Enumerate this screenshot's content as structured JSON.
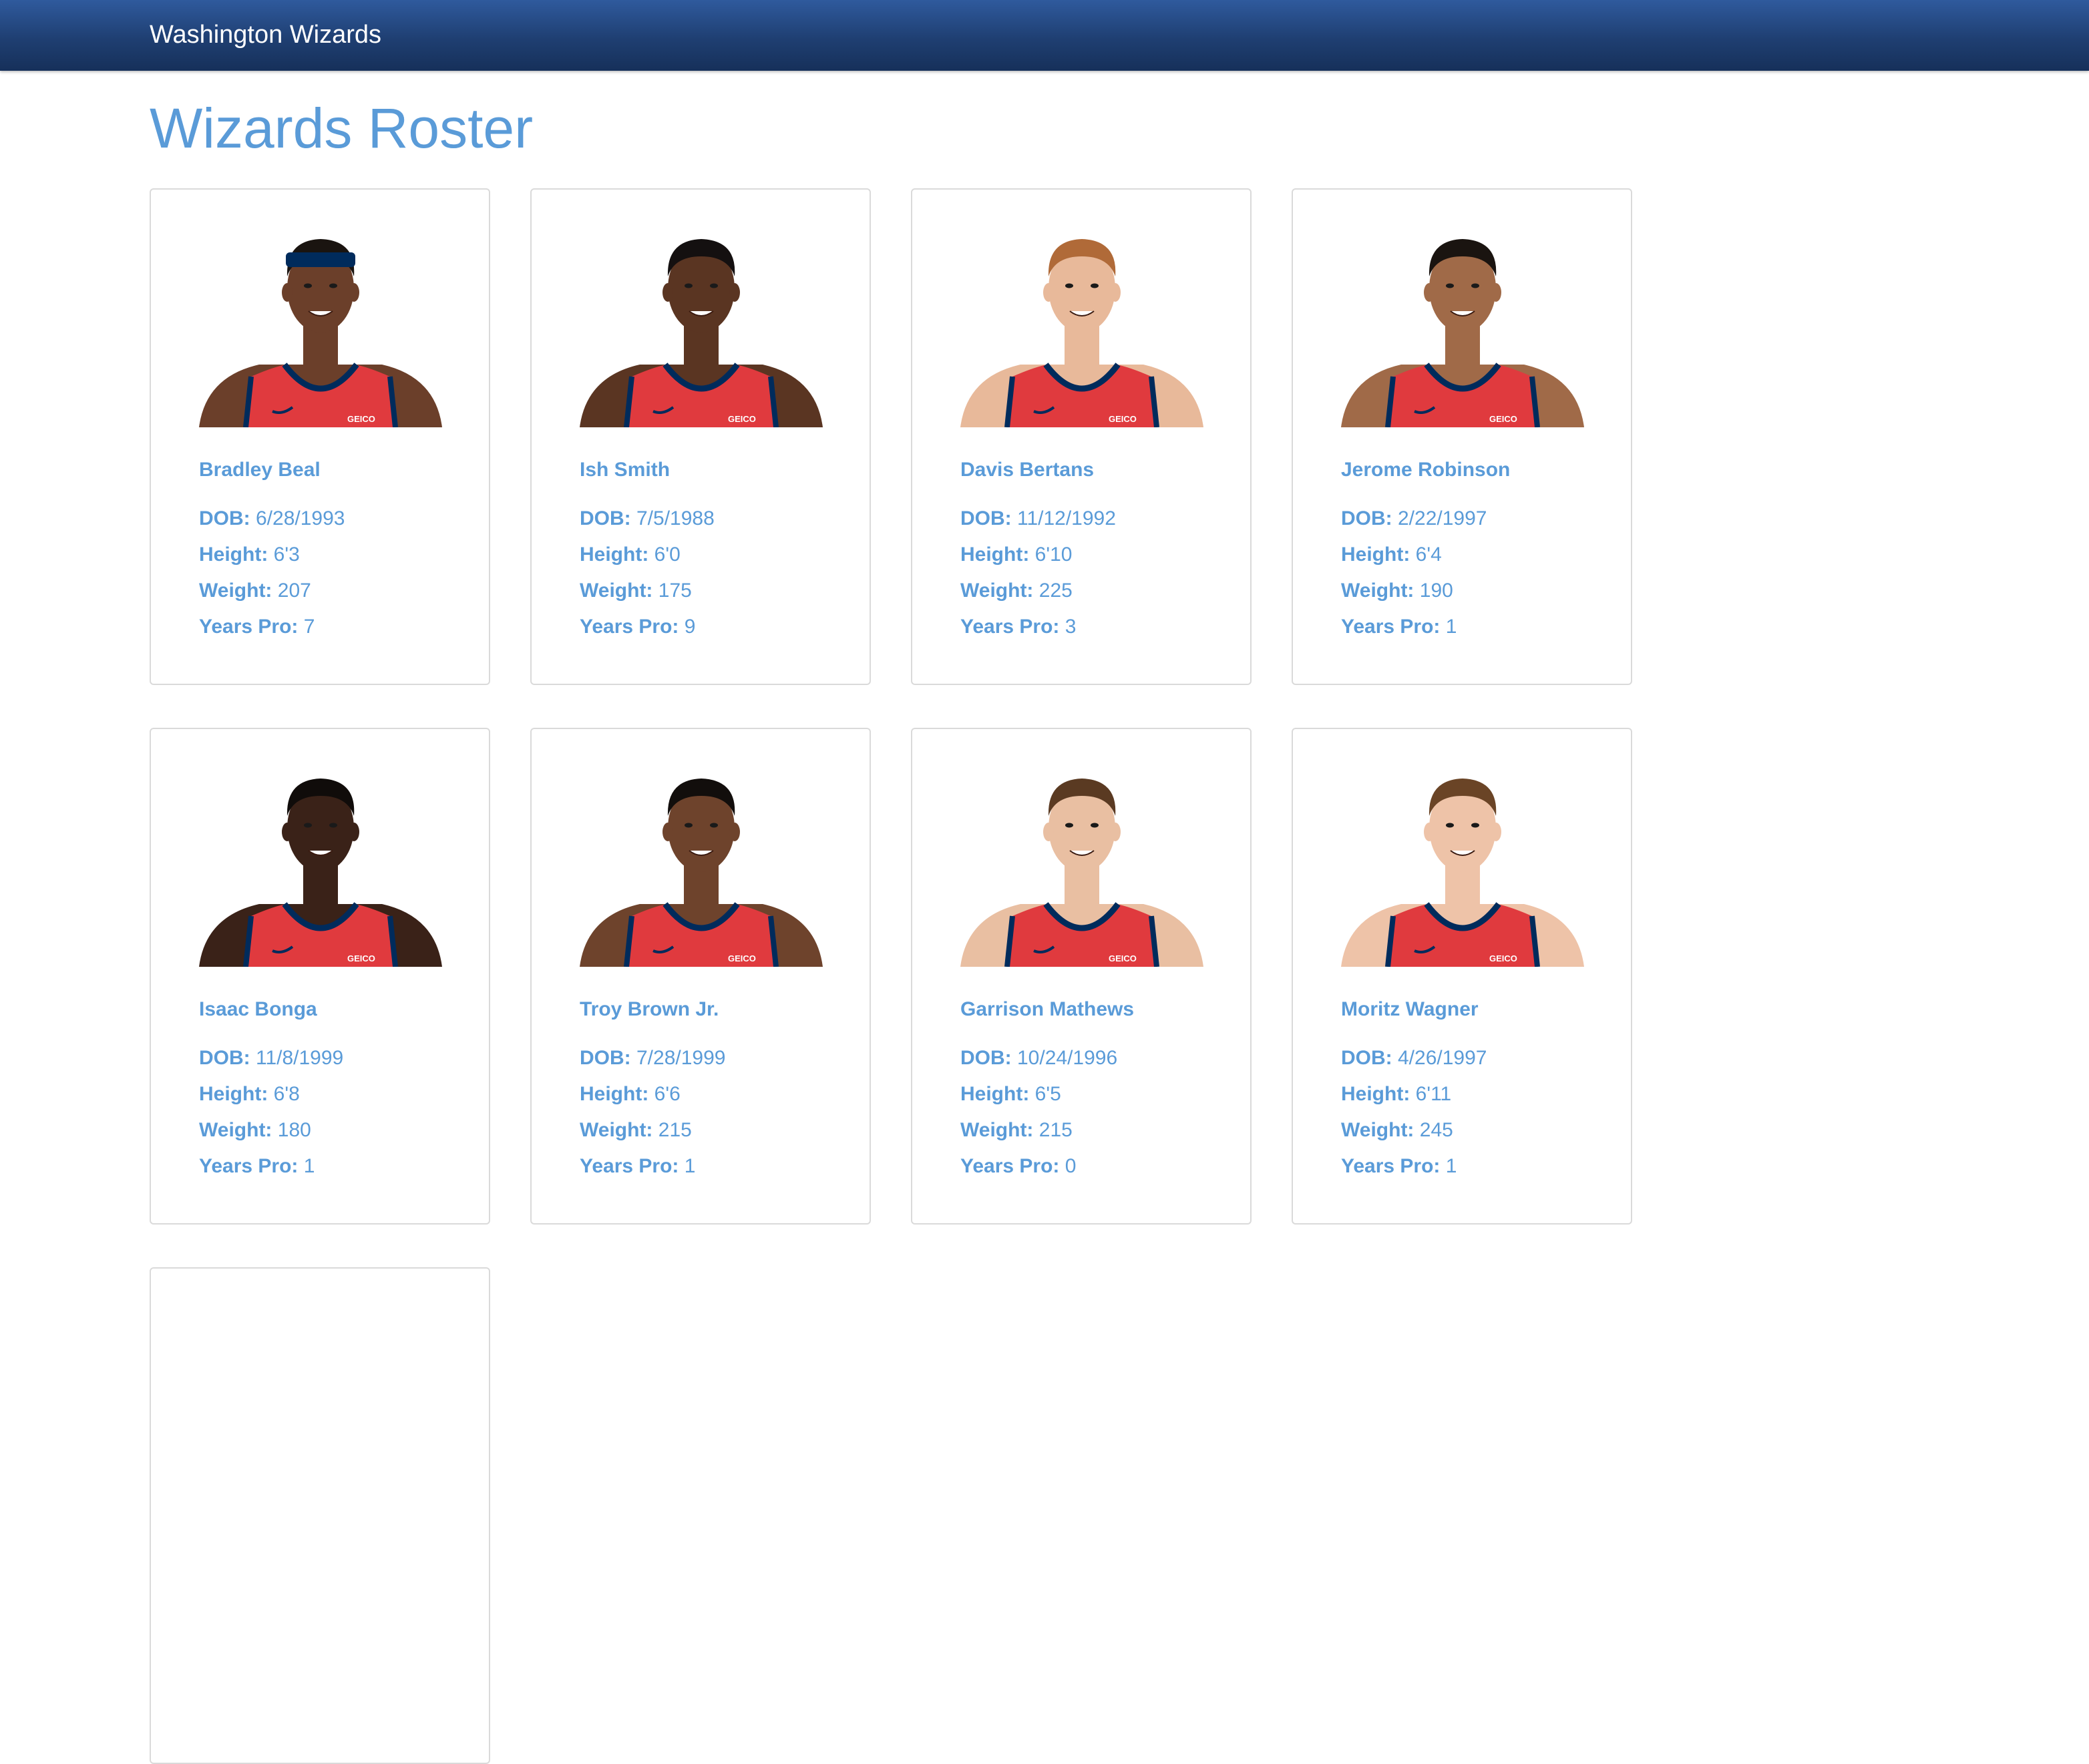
{
  "navbar": {
    "brand": "Washington Wizards"
  },
  "page": {
    "title": "Wizards Roster"
  },
  "labels": {
    "dob": "DOB:",
    "height": "Height:",
    "weight": "Weight:",
    "years_pro": "Years Pro:"
  },
  "colors": {
    "navbar": "#1f3f72",
    "accent_text": "#5a9bd8",
    "jersey_red": "#e03a3e",
    "jersey_navy": "#002b5c"
  },
  "players": [
    {
      "name": "Bradley Beal",
      "dob": "6/28/1993",
      "height": "6'3",
      "weight": "207",
      "years_pro": "7",
      "skin": "#6b3f2a",
      "hair": "#1a1410",
      "headband": true,
      "jersey_logo": "GEICO"
    },
    {
      "name": "Ish Smith",
      "dob": "7/5/1988",
      "height": "6'0",
      "weight": "175",
      "years_pro": "9",
      "skin": "#5a3522",
      "hair": "#141010",
      "headband": false,
      "jersey_logo": "GEICO"
    },
    {
      "name": "Davis Bertans",
      "dob": "11/12/1992",
      "height": "6'10",
      "weight": "225",
      "years_pro": "3",
      "skin": "#e8b99a",
      "hair": "#b06a38",
      "headband": false,
      "jersey_logo": "GEICO"
    },
    {
      "name": "Jerome Robinson",
      "dob": "2/22/1997",
      "height": "6'4",
      "weight": "190",
      "years_pro": "1",
      "skin": "#a06a48",
      "hair": "#1a1410",
      "headband": false,
      "jersey_logo": "GEICO"
    },
    {
      "name": "Isaac Bonga",
      "dob": "11/8/1999",
      "height": "6'8",
      "weight": "180",
      "years_pro": "1",
      "skin": "#3a2218",
      "hair": "#100c0a",
      "headband": false,
      "jersey_logo": "GEICO"
    },
    {
      "name": "Troy Brown Jr.",
      "dob": "7/28/1999",
      "height": "6'6",
      "weight": "215",
      "years_pro": "1",
      "skin": "#6e432c",
      "hair": "#120e0c",
      "headband": false,
      "jersey_logo": "GEICO"
    },
    {
      "name": "Garrison Mathews",
      "dob": "10/24/1996",
      "height": "6'5",
      "weight": "215",
      "years_pro": "0",
      "skin": "#e9bfa2",
      "hair": "#5a3a22",
      "headband": false,
      "jersey_logo": "GEICO"
    },
    {
      "name": "Moritz Wagner",
      "dob": "4/26/1997",
      "height": "6'11",
      "weight": "245",
      "years_pro": "1",
      "skin": "#eec3a8",
      "hair": "#6a4426",
      "headband": false,
      "jersey_logo": "GEICO"
    }
  ]
}
